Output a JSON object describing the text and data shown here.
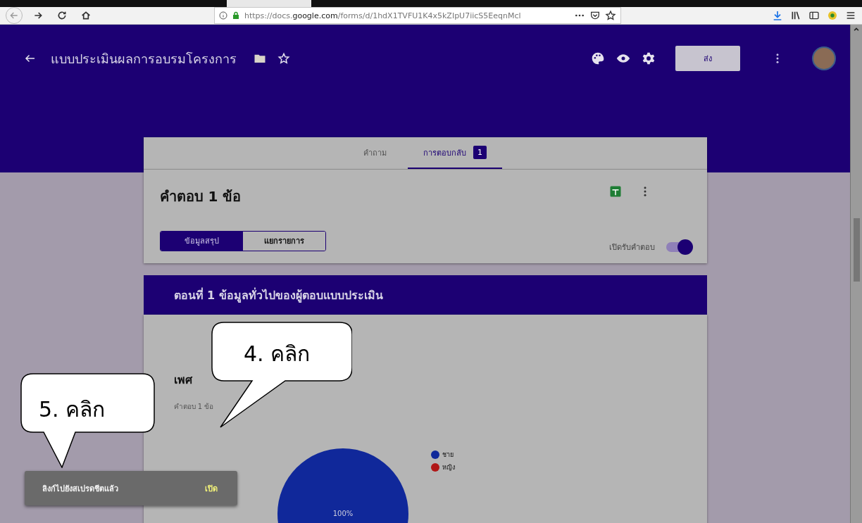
{
  "browser": {
    "url": "https://docs.**google.com**/forms/d/1hdX1TVFU1K4x5kZIpU7iicS5EeqnMcl"
  },
  "header": {
    "title": "แบบประเมินผลการอบรมโครงการ",
    "send_button": "ส่ง"
  },
  "tabs": [
    {
      "label": "คำถาม",
      "selected": false
    },
    {
      "label": "การตอบกลับ",
      "selected": true,
      "badge": "1"
    }
  ],
  "summary": {
    "title": "คำตอบ 1 ข้อ",
    "views": [
      {
        "label": "ข้อมูลสรุป",
        "selected": true
      },
      {
        "label": "แยกรายการ",
        "selected": false
      }
    ],
    "accepting": {
      "label": "เปิดรับคำตอบ",
      "on": true
    }
  },
  "section": {
    "title": "ตอนที่ 1 ข้อมูลทั่วไปของผู้ตอบแบบประเมิน"
  },
  "question": {
    "title": "เพศ",
    "subtitle": "คำตอบ 1 ข้อ",
    "legend": [
      {
        "color": "#10289a"
      },
      {
        "color": "#b01818"
      }
    ],
    "chart_data": {
      "type": "pie",
      "categories": [
        "ชาย",
        "หญิง"
      ],
      "values": [
        100,
        0
      ],
      "value_labels": [
        "100%",
        null
      ]
    }
  },
  "snackbar": {
    "message": "ลิงก์ไปยังสเปรดชีตแล้ว",
    "action": "เปิด"
  },
  "callouts": [
    {
      "text": "4. คลิก"
    },
    {
      "text": "5. คลิก"
    }
  ]
}
